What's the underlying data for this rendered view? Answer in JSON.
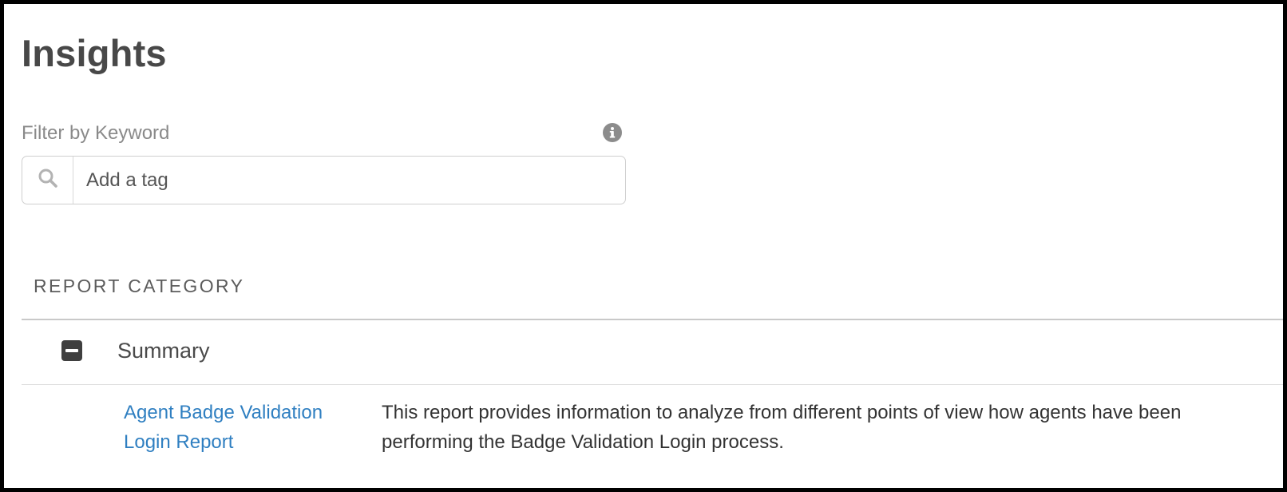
{
  "page": {
    "title": "Insights"
  },
  "filter": {
    "label": "Filter by Keyword",
    "info_icon": "info-circle-icon",
    "search_icon": "search-icon",
    "placeholder": "Add a tag",
    "value": ""
  },
  "report_category": {
    "header": "REPORT CATEGORY",
    "categories": [
      {
        "label": "Summary",
        "toggle_icon": "minus-square-icon",
        "expanded": true,
        "reports": [
          {
            "name": "Agent Badge Validation Login Report",
            "description": "This report provides information to analyze from different points of view how agents have been performing the Badge Validation Login process."
          }
        ]
      }
    ]
  },
  "colors": {
    "link": "#2f7fc1",
    "title": "#484848",
    "muted_label": "#8a8a8a",
    "frame_border": "#000000"
  }
}
